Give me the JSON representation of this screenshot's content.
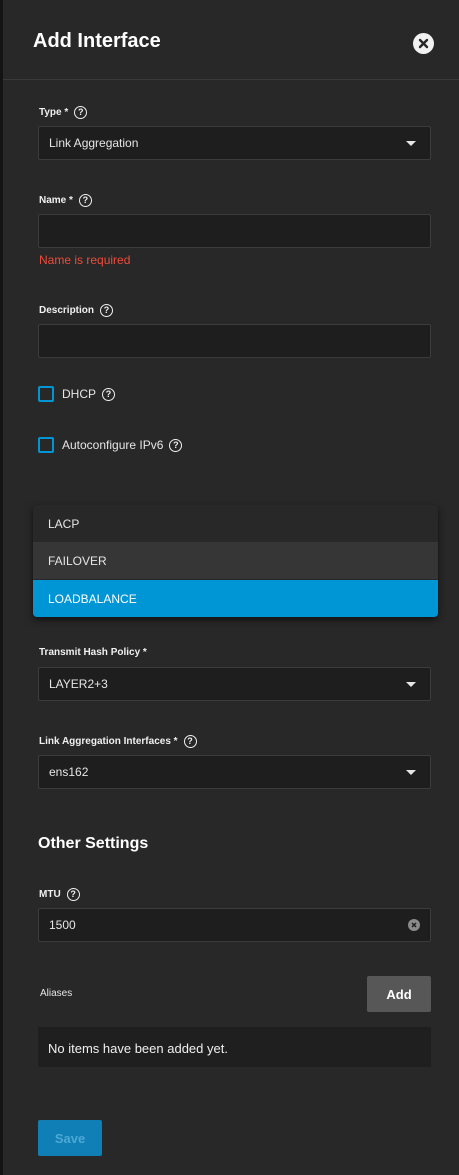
{
  "header": {
    "title": "Add Interface"
  },
  "type_field": {
    "label": "Type *",
    "value": "Link Aggregation"
  },
  "name_field": {
    "label": "Name *",
    "value": "",
    "error": "Name is required"
  },
  "description_field": {
    "label": "Description",
    "value": ""
  },
  "dhcp": {
    "label": "DHCP",
    "checked": false
  },
  "autoconfig_ipv6": {
    "label": "Autoconfigure IPv6",
    "checked": false
  },
  "lag_protocol_dropdown": {
    "options": [
      "LACP",
      "FAILOVER",
      "LOADBALANCE"
    ],
    "selected": "LOADBALANCE",
    "hovered": "FAILOVER"
  },
  "transmit_hash_policy": {
    "label": "Transmit Hash Policy *",
    "value": "LAYER2+3"
  },
  "lag_interfaces": {
    "label": "Link Aggregation Interfaces *",
    "value": "ens162"
  },
  "other_settings": {
    "title": "Other Settings"
  },
  "mtu": {
    "label": "MTU",
    "value": "1500"
  },
  "aliases": {
    "label": "Aliases",
    "add_label": "Add",
    "empty_text": "No items have been added yet."
  },
  "footer": {
    "save_label": "Save"
  },
  "colors": {
    "accent": "#0095d5",
    "error": "#ef4b3a",
    "panel_bg": "#282828",
    "selected_option_bg": "#0095d5",
    "hover_option_bg": "#363636"
  },
  "icons": [
    "close-icon",
    "help-icon",
    "dropdown-caret-icon",
    "clear-icon"
  ]
}
